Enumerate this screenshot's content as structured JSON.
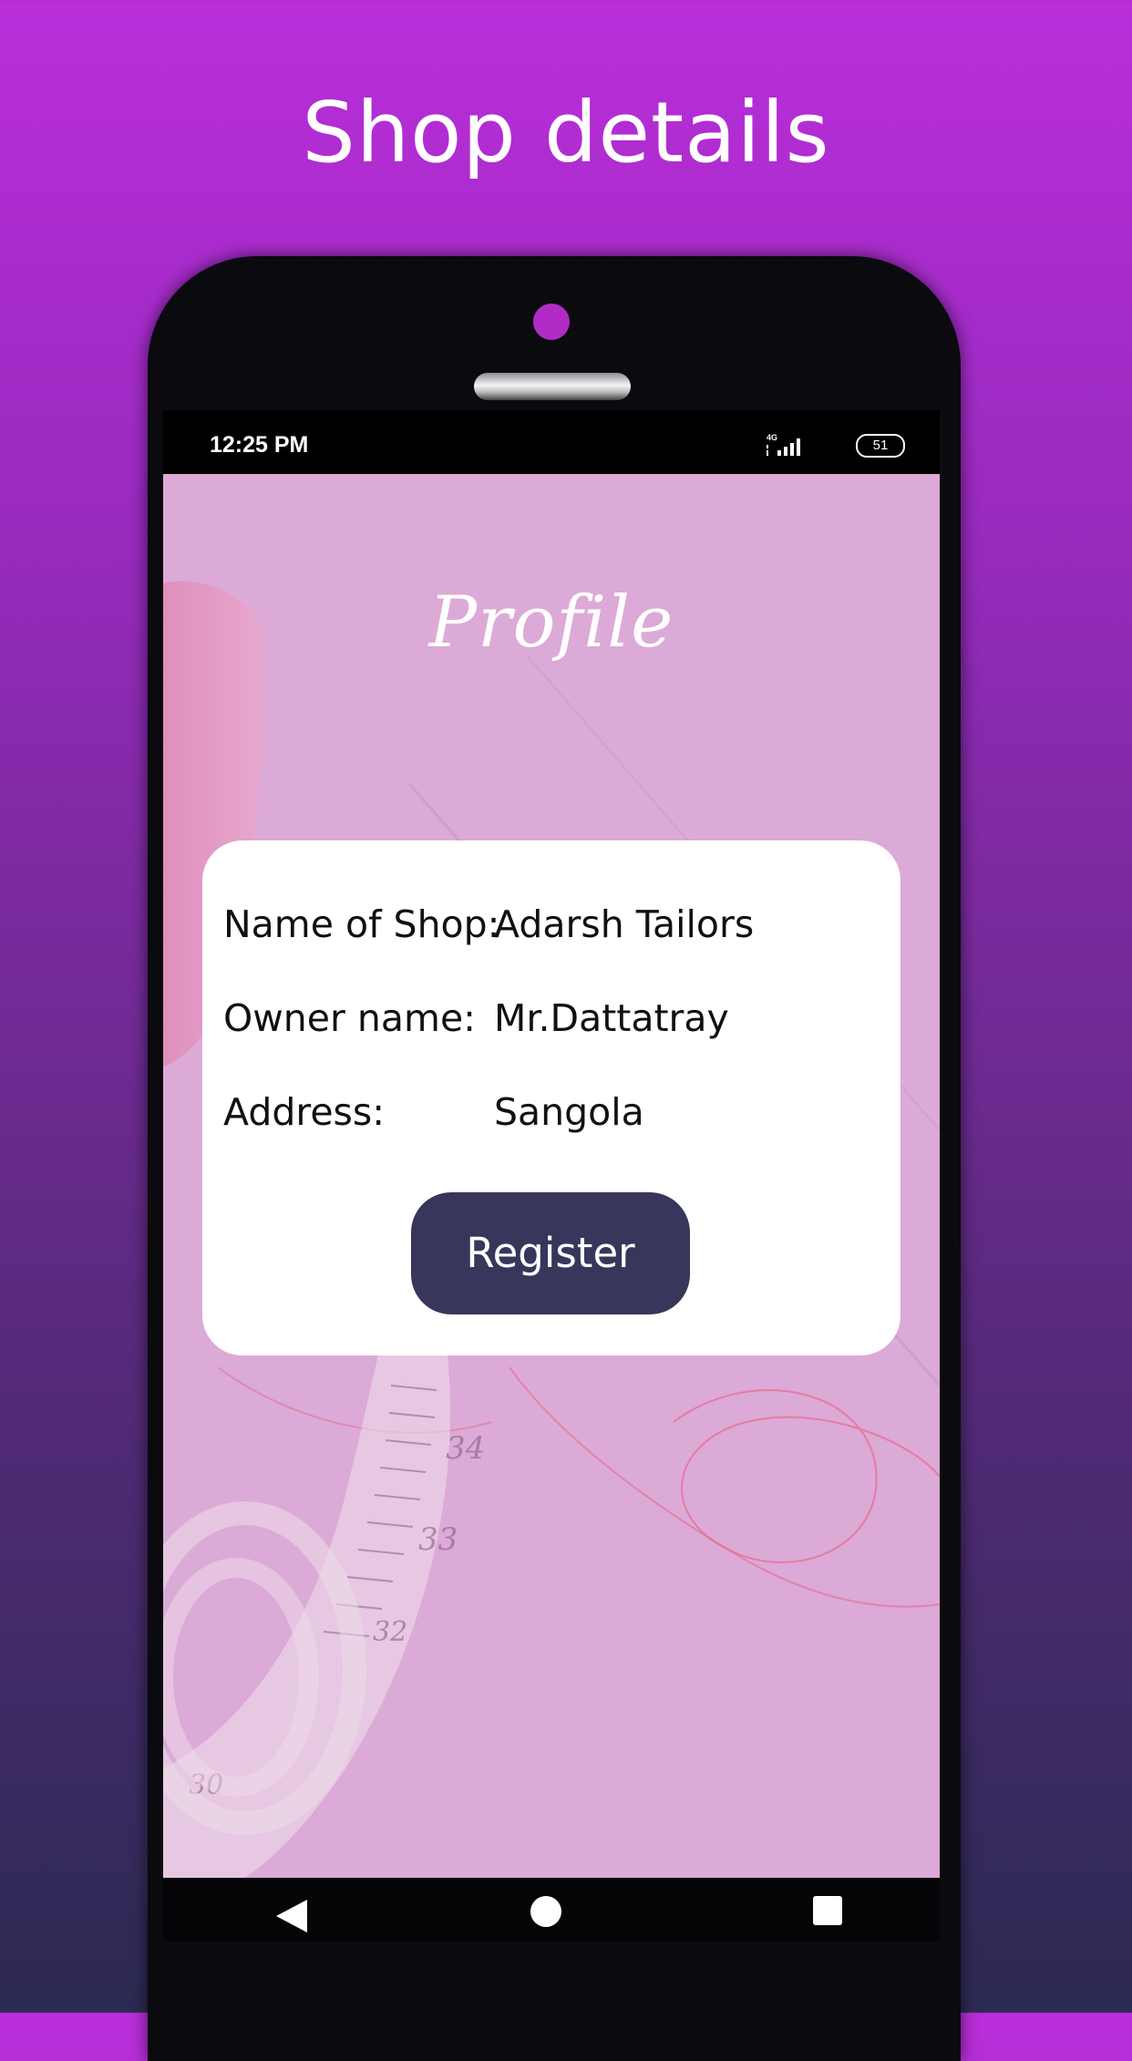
{
  "header": {
    "title": "Shop details"
  },
  "status_bar": {
    "time": "12:25 PM",
    "network": "4G",
    "battery": "51"
  },
  "screen": {
    "title": "Profile",
    "details": [
      {
        "label": "Name of Shop:",
        "value": "Adarsh Tailors"
      },
      {
        "label": "Owner name:",
        "value": "Mr.Dattatray"
      },
      {
        "label": "Address:",
        "value": "Sangola"
      }
    ],
    "register_label": "Register",
    "tape_numbers": [
      "34",
      "33",
      "32",
      "30"
    ]
  },
  "nav": {
    "back_icon": "back-icon",
    "home_icon": "home-icon",
    "recent_icon": "recent-apps-icon"
  },
  "colors": {
    "background_top": "#b92ed9",
    "background_bottom": "#2c2a52",
    "app_background": "#dcaad6",
    "button": "#38365a",
    "card": "#ffffff"
  }
}
